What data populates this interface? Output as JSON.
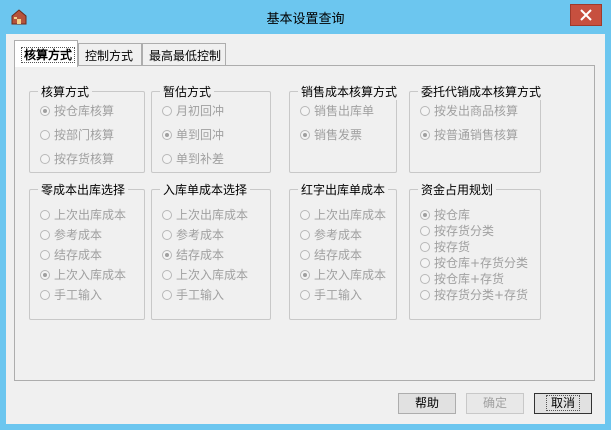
{
  "window": {
    "title": "基本设置查询"
  },
  "tabs": [
    {
      "label": "核算方式",
      "active": true
    },
    {
      "label": "控制方式",
      "active": false
    },
    {
      "label": "最高最低控制",
      "active": false
    }
  ],
  "groups": {
    "accounting_method": {
      "title": "核算方式",
      "options": [
        {
          "label": "按仓库核算",
          "checked": true
        },
        {
          "label": "按部门核算",
          "checked": false
        },
        {
          "label": "按存货核算",
          "checked": false
        }
      ]
    },
    "provisional_method": {
      "title": "暂估方式",
      "options": [
        {
          "label": "月初回冲",
          "checked": false
        },
        {
          "label": "单到回冲",
          "checked": true
        },
        {
          "label": "单到补差",
          "checked": false
        }
      ]
    },
    "sales_cost_method": {
      "title": "销售成本核算方式",
      "options": [
        {
          "label": "销售出库单",
          "checked": false
        },
        {
          "label": "销售发票",
          "checked": true
        }
      ]
    },
    "consignment_cost_method": {
      "title": "委托代销成本核算方式",
      "options": [
        {
          "label": "按发出商品核算",
          "checked": false
        },
        {
          "label": "按普通销售核算",
          "checked": true
        }
      ]
    },
    "zero_cost_outbound": {
      "title": "零成本出库选择",
      "options": [
        {
          "label": "上次出库成本",
          "checked": false
        },
        {
          "label": "参考成本",
          "checked": false
        },
        {
          "label": "结存成本",
          "checked": false
        },
        {
          "label": "上次入库成本",
          "checked": true
        },
        {
          "label": "手工输入",
          "checked": false
        }
      ]
    },
    "inbound_cost": {
      "title": "入库单成本选择",
      "options": [
        {
          "label": "上次出库成本",
          "checked": false
        },
        {
          "label": "参考成本",
          "checked": false
        },
        {
          "label": "结存成本",
          "checked": true
        },
        {
          "label": "上次入库成本",
          "checked": false
        },
        {
          "label": "手工输入",
          "checked": false
        }
      ]
    },
    "red_outbound_cost": {
      "title": "红字出库单成本",
      "options": [
        {
          "label": "上次出库成本",
          "checked": false
        },
        {
          "label": "参考成本",
          "checked": false
        },
        {
          "label": "结存成本",
          "checked": false
        },
        {
          "label": "上次入库成本",
          "checked": true
        },
        {
          "label": "手工输入",
          "checked": false
        }
      ]
    },
    "capital_planning": {
      "title": "资金占用规划",
      "options": [
        {
          "label": "按仓库",
          "checked": true
        },
        {
          "label": "按存货分类",
          "checked": false
        },
        {
          "label": "按存货",
          "checked": false
        },
        {
          "label": "按仓库+存货分类",
          "checked": false
        },
        {
          "label": "按仓库+存货",
          "checked": false
        },
        {
          "label": "按存货分类+存货",
          "checked": false
        }
      ]
    }
  },
  "buttons": {
    "help": "帮助",
    "ok": "确定",
    "cancel": "取消"
  },
  "icons": {
    "app": "app-icon",
    "close": "close-icon"
  },
  "colors": {
    "titlebar": "#6cc6ef",
    "close_button": "#c7503f"
  }
}
